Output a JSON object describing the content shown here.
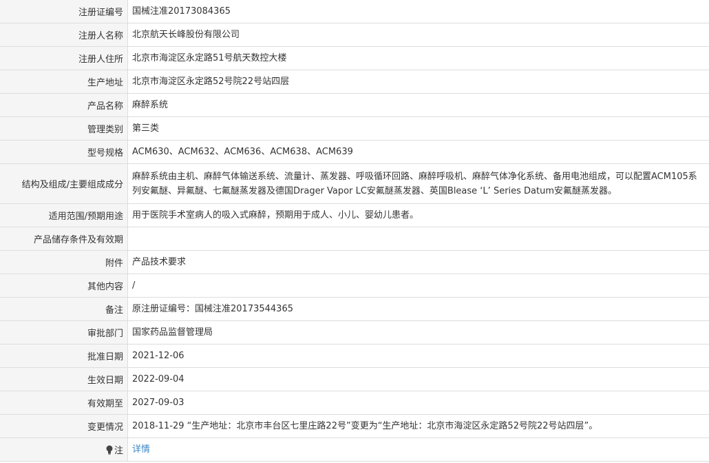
{
  "rows": [
    {
      "label": "注册证编号",
      "value": "国械注准20173084365"
    },
    {
      "label": "注册人名称",
      "value": "北京航天长峰股份有限公司"
    },
    {
      "label": "注册人住所",
      "value": "北京市海淀区永定路51号航天数控大楼"
    },
    {
      "label": "生产地址",
      "value": "北京市海淀区永定路52号院22号站四层"
    },
    {
      "label": "产品名称",
      "value": "麻醉系统"
    },
    {
      "label": "管理类别",
      "value": "第三类"
    },
    {
      "label": "型号规格",
      "value": "ACM630、ACM632、ACM636、ACM638、ACM639"
    },
    {
      "label": "结构及组成/主要组成成分",
      "value": "麻醉系统由主机、麻醉气体输送系统、流量计、蒸发器、呼吸循环回路、麻醉呼吸机、麻醉气体净化系统、备用电池组成，可以配置ACM105系列安氟醚、异氟醚、七氟醚蒸发器及德国Drager Vapor LC安氟醚蒸发器、英国Blease ‘L’ Series Datum安氟醚蒸发器。"
    },
    {
      "label": "适用范围/预期用途",
      "value": "用于医院手术室病人的吸入式麻醉，预期用于成人、小儿、婴幼儿患者。"
    },
    {
      "label": "产品储存条件及有效期",
      "value": ""
    },
    {
      "label": "附件",
      "value": "产品技术要求"
    },
    {
      "label": "其他内容",
      "value": "/"
    },
    {
      "label": "备注",
      "value": "原注册证编号：国械注准20173544365"
    },
    {
      "label": "审批部门",
      "value": "国家药品监督管理局"
    },
    {
      "label": "批准日期",
      "value": "2021-12-06"
    },
    {
      "label": "生效日期",
      "value": "2022-09-04"
    },
    {
      "label": "有效期至",
      "value": "2027-09-03"
    },
    {
      "label": "变更情况",
      "value": "2018-11-29 “生产地址：北京市丰台区七里庄路22号”变更为“生产地址：北京市海淀区永定路52号院22号站四层”。"
    }
  ],
  "note": {
    "label": "注",
    "link_text": "详情",
    "icon": "lightbulb-icon"
  }
}
